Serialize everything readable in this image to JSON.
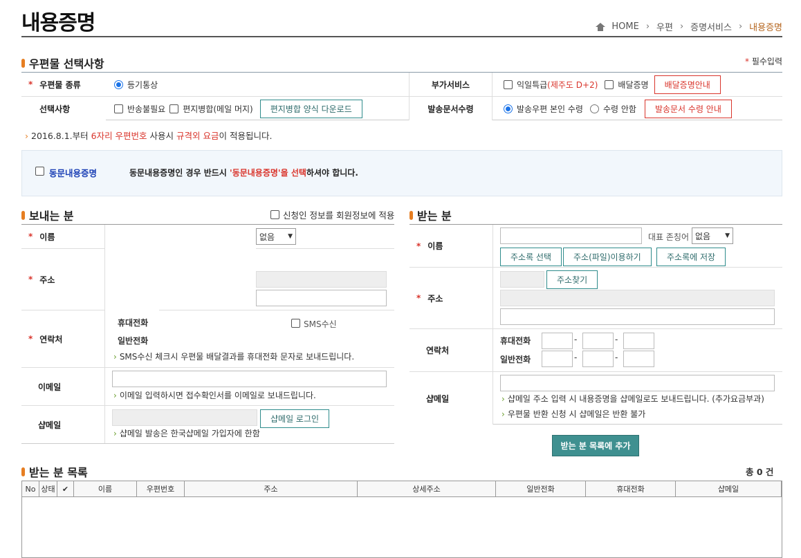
{
  "page": {
    "title": "내용증명"
  },
  "breadcrumb": {
    "home": "HOME",
    "items": [
      "우편",
      "증명서비스"
    ],
    "current": "내용증명"
  },
  "section1": {
    "title": "우편물 선택사항",
    "required_note": "필수입력",
    "required_mark": "*"
  },
  "mail_type": {
    "label": "우편물 종류",
    "option": "등기통상"
  },
  "extra_service": {
    "label": "부가서비스",
    "opt1": "익일특급",
    "opt1_note": "(제주도 D+2)",
    "opt2": "배달증명",
    "btn": "배달증명안내"
  },
  "options": {
    "label": "선택사항",
    "opt1": "반송불필요",
    "opt2": "편지병합(메일 머지)",
    "btn": "편지병합 양식 다운로드"
  },
  "receipt": {
    "label": "발송문서수령",
    "opt1": "발송우편 본인 수령",
    "opt2": "수령 안함",
    "btn": "발송문서 수령 안내"
  },
  "notice": {
    "prefix": "2016.8.1.부터 ",
    "hl1": "6자리 우편번호",
    "mid": " 사용시 ",
    "hl2": "규격외 요금",
    "suffix": "이 적용됩니다."
  },
  "joint": {
    "label": "동문내용증명",
    "text_a": "동문내용증명인 경우 반드시 ",
    "text_hl": "'동문내용증명'을 선택",
    "text_b": "하셔야 합니다."
  },
  "sender": {
    "title": "보내는 분",
    "apply_member": "신청인 정보를 회원정보에 적용",
    "name_label": "이름",
    "honorific_value": "없음",
    "addr_label": "주소",
    "contact_label": "연락처",
    "mobile_label": "휴대전화",
    "phone_label": "일반전화",
    "sms_label": "SMS수신",
    "sms_hint": "SMS수신 체크시 우편물 배달결과를 휴대전화 문자로 보내드립니다.",
    "email_label": "이메일",
    "email_hint": "이메일 입력하시면 접수확인서를 이메일로 보내드립니다.",
    "shop_label": "샵메일",
    "shop_btn": "샵메일 로그인",
    "shop_hint": "샵메일 발송은 한국샵메일 가입자에 한함"
  },
  "receiver": {
    "title": "받는 분",
    "name_label": "이름",
    "honorific_label": "대표 존칭어",
    "honorific_value": "없음",
    "btn_addrbook": "주소록 선택",
    "btn_file": "주소(파일)이용하기",
    "btn_save": "주소록에 저장",
    "addr_label": "주소",
    "btn_find": "주소찾기",
    "contact_label": "연락처",
    "mobile_label": "휴대전화",
    "phone_label": "일반전화",
    "dash": "-",
    "shop_label": "샵메일",
    "shop_hint1": "샵메일 주소 입력 시 내용증명을 샵메일로도 보내드립니다. (추가요금부과)",
    "shop_hint2": "우편물 반환 신청 시 샵메일은 반환 불가",
    "add_btn": "받는 분 목록에 추가"
  },
  "list": {
    "title": "받는 분 목록",
    "total": "총 0 건",
    "columns": [
      "No",
      "상태",
      "✔",
      "이름",
      "우편번호",
      "주소",
      "상세주소",
      "일반전화",
      "휴대전화",
      "샵메일"
    ]
  },
  "colors": {
    "accent": "#e67e22",
    "red": "#d9342b",
    "teal": "#3f9090",
    "blue_text": "#1a3fb5"
  }
}
